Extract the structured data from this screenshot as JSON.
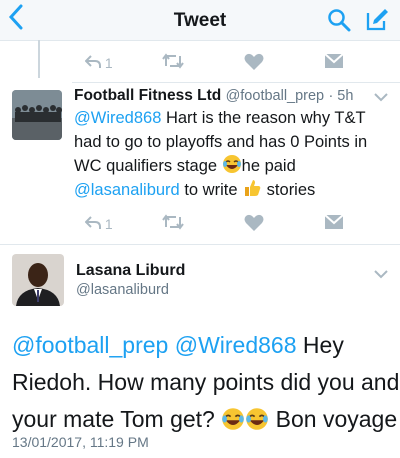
{
  "header": {
    "title": "Tweet"
  },
  "prev_tweet_actions": {
    "reply_count": "1"
  },
  "quoted_tweet": {
    "author_name": "Football Fitness Ltd",
    "handle": "@football_prep",
    "time": "· 5h",
    "mention1": "@Wired868",
    "line1_rest": " Hart is the reason why T&T",
    "line2": "had to go to playoffs and has 0 Points in",
    "line3_text": "WC qualifiers stage ",
    "line3_rest": "he paid",
    "mention2": "@lasanaliburd",
    "line4_mid": " to write ",
    "line4_end": " stories",
    "reply_count": "1"
  },
  "main_tweet": {
    "author_name": "Lasana Liburd",
    "handle": "@lasanaliburd",
    "mention1": "@football_prep",
    "mention2": "@Wired868",
    "line1_end": " Hey",
    "line2": "Riedoh. How many points did you and",
    "line3_start": "your mate Tom get? ",
    "line3_end": " Bon voyage",
    "timestamp": "13/01/2017, 11:19 PM"
  }
}
